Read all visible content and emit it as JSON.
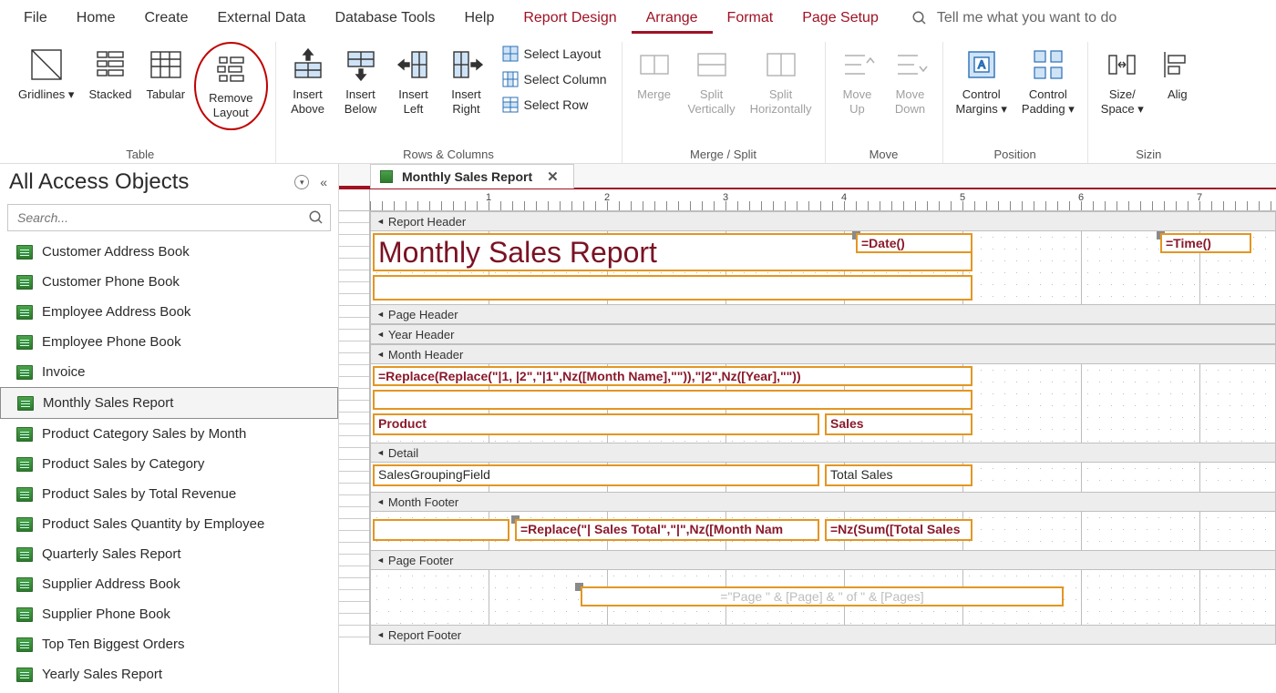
{
  "menubar": {
    "items": [
      "File",
      "Home",
      "Create",
      "External Data",
      "Database Tools",
      "Help",
      "Report Design",
      "Arrange",
      "Format",
      "Page Setup"
    ],
    "red_from_index": 6,
    "active_index": 7,
    "tell_me_placeholder": "Tell me what you want to do"
  },
  "ribbon": {
    "groups": {
      "table": {
        "label": "Table",
        "items": [
          {
            "name": "gridlines",
            "label": "Gridlines",
            "dropdown": true
          },
          {
            "name": "stacked",
            "label": "Stacked"
          },
          {
            "name": "tabular",
            "label": "Tabular"
          },
          {
            "name": "remove-layout",
            "label": "Remove\nLayout",
            "highlighted": true
          }
        ]
      },
      "rows_cols": {
        "label": "Rows & Columns",
        "items": [
          {
            "name": "insert-above",
            "label": "Insert\nAbove"
          },
          {
            "name": "insert-below",
            "label": "Insert\nBelow"
          },
          {
            "name": "insert-left",
            "label": "Insert\nLeft"
          },
          {
            "name": "insert-right",
            "label": "Insert\nRight"
          }
        ],
        "mini": [
          {
            "name": "select-layout",
            "label": "Select Layout"
          },
          {
            "name": "select-column",
            "label": "Select Column"
          },
          {
            "name": "select-row",
            "label": "Select Row"
          }
        ]
      },
      "merge_split": {
        "label": "Merge / Split",
        "items": [
          {
            "name": "merge",
            "label": "Merge",
            "disabled": true
          },
          {
            "name": "split-vertically",
            "label": "Split\nVertically",
            "disabled": true
          },
          {
            "name": "split-horizontally",
            "label": "Split\nHorizontally",
            "disabled": true
          }
        ]
      },
      "move": {
        "label": "Move",
        "items": [
          {
            "name": "move-up",
            "label": "Move\nUp",
            "disabled": true
          },
          {
            "name": "move-down",
            "label": "Move\nDown",
            "disabled": true
          }
        ]
      },
      "position": {
        "label": "Position",
        "items": [
          {
            "name": "control-margins",
            "label": "Control\nMargins",
            "dropdown": true
          },
          {
            "name": "control-padding",
            "label": "Control\nPadding",
            "dropdown": true
          }
        ]
      },
      "sizing": {
        "label": "Sizin",
        "items": [
          {
            "name": "size-space",
            "label": "Size/\nSpace",
            "dropdown": true
          },
          {
            "name": "align",
            "label": "Alig"
          }
        ]
      }
    }
  },
  "navpane": {
    "title": "All Access Objects",
    "search_placeholder": "Search...",
    "items": [
      "Customer Address Book",
      "Customer Phone Book",
      "Employee Address Book",
      "Employee Phone Book",
      "Invoice",
      "Monthly Sales Report",
      "Product Category Sales by Month",
      "Product Sales by Category",
      "Product Sales by Total Revenue",
      "Product Sales Quantity by Employee",
      "Quarterly Sales Report",
      "Supplier Address Book",
      "Supplier Phone Book",
      "Top Ten Biggest Orders",
      "Yearly Sales Report"
    ],
    "selected_index": 5
  },
  "workarea": {
    "tab_title": "Monthly Sales Report",
    "ruler_marks": [
      1,
      2,
      3,
      4,
      5,
      6,
      7
    ],
    "sections": {
      "report_header": "Report Header",
      "page_header": "Page Header",
      "year_header": "Year Header",
      "month_header": "Month Header",
      "detail": "Detail",
      "month_footer": "Month Footer",
      "page_footer": "Page Footer",
      "report_footer": "Report Footer"
    },
    "controls": {
      "title": "Monthly Sales Report",
      "date": "=Date()",
      "time": "=Time()",
      "month_expr": "=Replace(Replace(\"|1, |2\",\"|1\",Nz([Month Name],\"\")),\"|2\",Nz([Year],\"\"))",
      "product_hdr": "Product",
      "sales_hdr": "Sales",
      "grouping_field": "SalesGroupingField",
      "total_sales": "Total Sales",
      "footer_expr1": "=Replace(\"| Sales Total\",\"|\",Nz([Month Nam",
      "footer_expr2": "=Nz(Sum([Total Sales",
      "page_expr": "=\"Page \" & [Page] & \" of \" & [Pages]"
    }
  }
}
